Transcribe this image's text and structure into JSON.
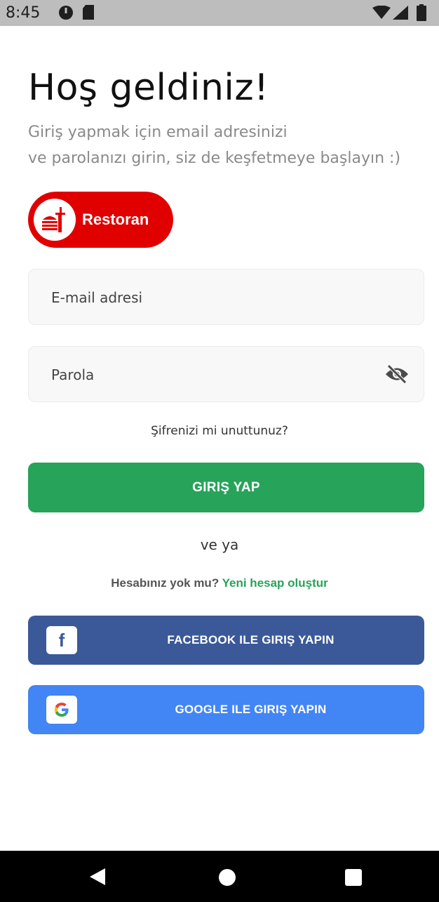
{
  "status_bar": {
    "time": "8:45"
  },
  "header": {
    "title": "Hoş geldiniz!",
    "subtitle_line1": "Giriş yapmak için email adresinizi",
    "subtitle_line2": "ve parolanızı girin, siz de keşfetmeye başlayın :)"
  },
  "role_toggle": {
    "label": "Restoran",
    "color": "#e00000",
    "icon": "restaurant-icon"
  },
  "form": {
    "email_placeholder": "E-mail adresi",
    "password_placeholder": "Parola",
    "password_toggle_icon": "eye-off-icon",
    "forgot_password": "Şifrenizi mi unuttunuz?",
    "login_button": "GIRIŞ YAP",
    "login_color": "#27a35a"
  },
  "separator": "ve ya",
  "signup": {
    "prompt": "Hesabınız yok mu?",
    "link": "Yeni hesap oluştur"
  },
  "social": {
    "facebook_label": "FACEBOOK ILE GIRIŞ YAPIN",
    "facebook_color": "#3b5998",
    "google_label": "GOOGLE ILE GIRIŞ YAPIN",
    "google_color": "#4285f4"
  }
}
